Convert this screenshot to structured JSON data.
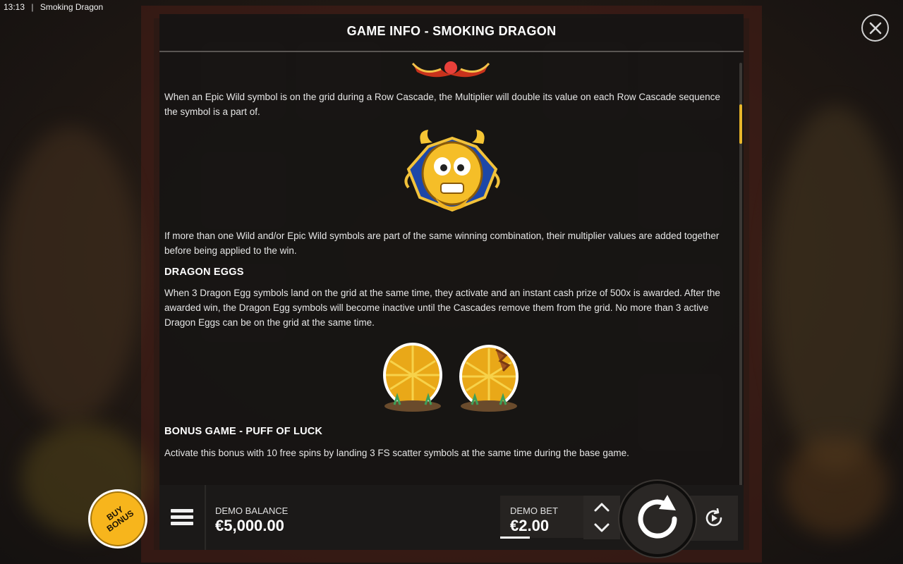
{
  "statusbar": {
    "time": "13:13",
    "separator": "|",
    "app_title": "Smoking Dragon"
  },
  "panel": {
    "title": "GAME INFO - SMOKING DRAGON"
  },
  "content": {
    "epic_wild_paragraph": "When an Epic Wild symbol is on the grid during a Row Cascade, the Multiplier will double its value on each Row Cascade sequence the symbol is a part of.",
    "multiplier_paragraph": "If more than one Wild and/or Epic Wild symbols are part of the same winning combination, their multiplier values are added together before being applied to the win.",
    "dragon_eggs_heading": "DRAGON EGGS",
    "dragon_eggs_paragraph": "When 3 Dragon Egg symbols land on the grid at the same time, they activate and an instant cash prize of 500x is awarded. After the awarded win, the Dragon Egg symbols will become inactive until the Cascades remove them from the grid. No more than 3 active Dragon Eggs can be on the grid at the same time.",
    "bonus_heading": "BONUS GAME - PUFF OF LUCK",
    "bonus_paragraph": "Activate this bonus with 10 free spins by landing 3 FS scatter symbols at the same time during the base game."
  },
  "bottom_bar": {
    "balance_label": "DEMO BALANCE",
    "balance_value": "€5,000.00",
    "bet_label": "DEMO BET",
    "bet_value": "€2.00"
  },
  "buy_bonus": {
    "label": "BUY\nBONUS"
  },
  "icons": {
    "close": "close-icon",
    "menu": "hamburger-menu-icon",
    "bet_up": "chevron-up-icon",
    "bet_down": "chevron-down-icon",
    "spin": "spin-arrow-icon",
    "autoplay": "autoplay-icon"
  },
  "colors": {
    "accent": "#f7b51c",
    "panel_bg": "#161413",
    "text": "#e6e6e6",
    "scroll_thumb": "#e8b52a"
  }
}
